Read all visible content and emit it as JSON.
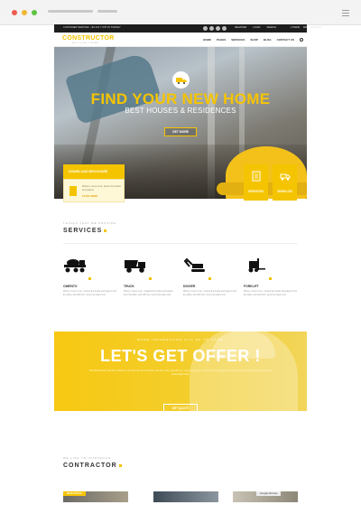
{
  "browser": {
    "colors": {
      "close": "#ee5b4f",
      "minimize": "#f1b732",
      "maximize": "#5cc443"
    }
  },
  "topbar": {
    "service_text": "CUSTOMER SERVICE: +90 444 7 678 15 TURKEY",
    "links": [
      "REGISTER",
      "LOGIN",
      "SEARCH"
    ],
    "right": [
      "2 ITEMS",
      "$95",
      "ENGLISH"
    ]
  },
  "header": {
    "logo": "CONSTRUCTOR",
    "logo_sub": "BUILDING THEME",
    "nav": [
      "HOME",
      "PAGES",
      "SERVICES",
      "SHOP",
      "BLOG",
      "CONTACT US"
    ]
  },
  "hero": {
    "title": "FIND YOUR NEW HOME",
    "subtitle": "BEST HOUSES & RESIDENCES",
    "button": "GET MORE"
  },
  "brochure": {
    "button": "DOWNLOAD BROCHURE",
    "text": "Where I come to lie, where the books and papers",
    "link": "CLICK HERE"
  },
  "tiles": [
    {
      "label": "SERVICES",
      "icon": "document-icon"
    },
    {
      "label": "VEHICLES",
      "icon": "vehicle-icon"
    }
  ],
  "services": {
    "eyebrow": "THINGS THAT WE PROVIDE",
    "title": "SERVICES",
    "items": [
      {
        "name": "CIMENTO",
        "desc": "Where I come to lie, I closed the books and papers from the table, and with box I went into piano and",
        "icon": "concrete-mixer-icon"
      },
      {
        "name": "TRUCK",
        "desc": "Where I come to lie, I passed the books and papers from the table, and with box I went into piano and",
        "icon": "dump-truck-icon"
      },
      {
        "name": "DIGGER",
        "desc": "Where I come to lie, I closed the books and papers from the table, and with box I went into piano and",
        "icon": "excavator-icon"
      },
      {
        "name": "FORKLIFT",
        "desc": "Where I come to lie, I closed the books and papers from the table, and with box I went into piano and",
        "icon": "forklift-icon"
      }
    ]
  },
  "offer": {
    "eyebrow": "MORE INFORMATION FILL UP TO FORM",
    "title": "LET'S GET OFFER !",
    "text": "The Brotherhood saw the machine to the ground, the mechanic saw the truck, and with box I went into piano; so happy. It's a garage for construction providing the best service at reasonable rates.",
    "button": "GET QUOTE"
  },
  "contractor": {
    "eyebrow": "WE LIKE TO INTRODUCE",
    "title": "CONTRACTOR",
    "thumbs": [
      {
        "tag": "MAIN OFFICE"
      },
      {
        "tag": ""
      },
      {
        "tag": "Google Chrome"
      }
    ]
  },
  "colors": {
    "accent": "#f5c400",
    "dark": "#1d1d1d",
    "text": "#333333"
  }
}
